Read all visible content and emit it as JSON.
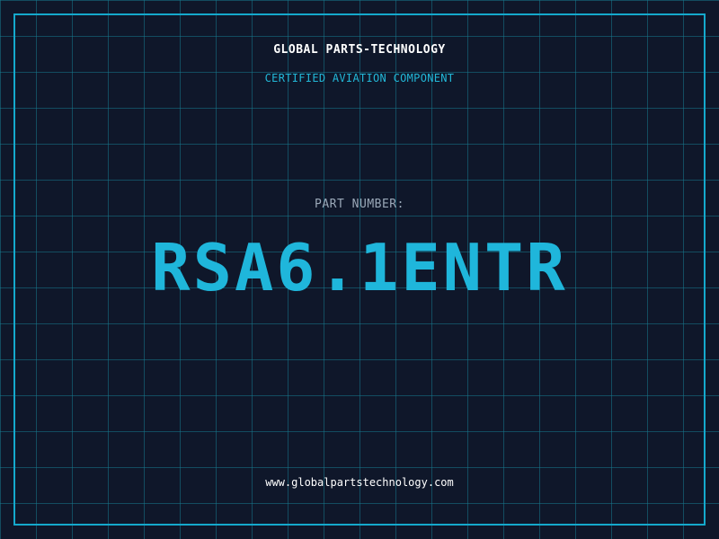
{
  "header": {
    "company": "GLOBAL PARTS-TECHNOLOGY",
    "tagline": "CERTIFIED AVIATION COMPONENT"
  },
  "part": {
    "label": "PART NUMBER:",
    "number": "RSA6.1ENTR"
  },
  "footer": {
    "website": "www.globalpartstechnology.com"
  },
  "colors": {
    "background": "#0f172a",
    "grid": "#16788c",
    "accent": "#14a9cc",
    "part_number": "#1fb6db",
    "label": "#9aa8b8",
    "text": "#ffffff"
  }
}
